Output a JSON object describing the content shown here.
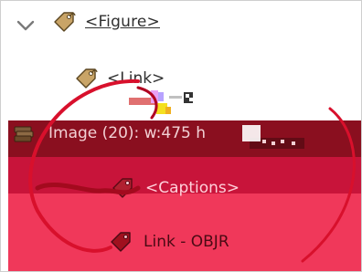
{
  "tree": {
    "figure": {
      "label": "<Figure>",
      "icon": "tag-icon"
    },
    "link": {
      "label": "<Link>",
      "icon": "tag-icon"
    },
    "image": {
      "label": "Image (20): w:475 h",
      "icon": "image-stack-icon"
    },
    "captions": {
      "label": "<Captions>",
      "icon": "tag-icon"
    },
    "link_objr": {
      "label": "Link - OBJR",
      "icon": "tag-icon"
    }
  },
  "colors": {
    "highlight_dark": "#8a0f1f",
    "highlight_mid": "#c8143a",
    "highlight_light": "#f0385a",
    "tag_fill": "#c9a467",
    "annotation_red": "#d8102c"
  }
}
